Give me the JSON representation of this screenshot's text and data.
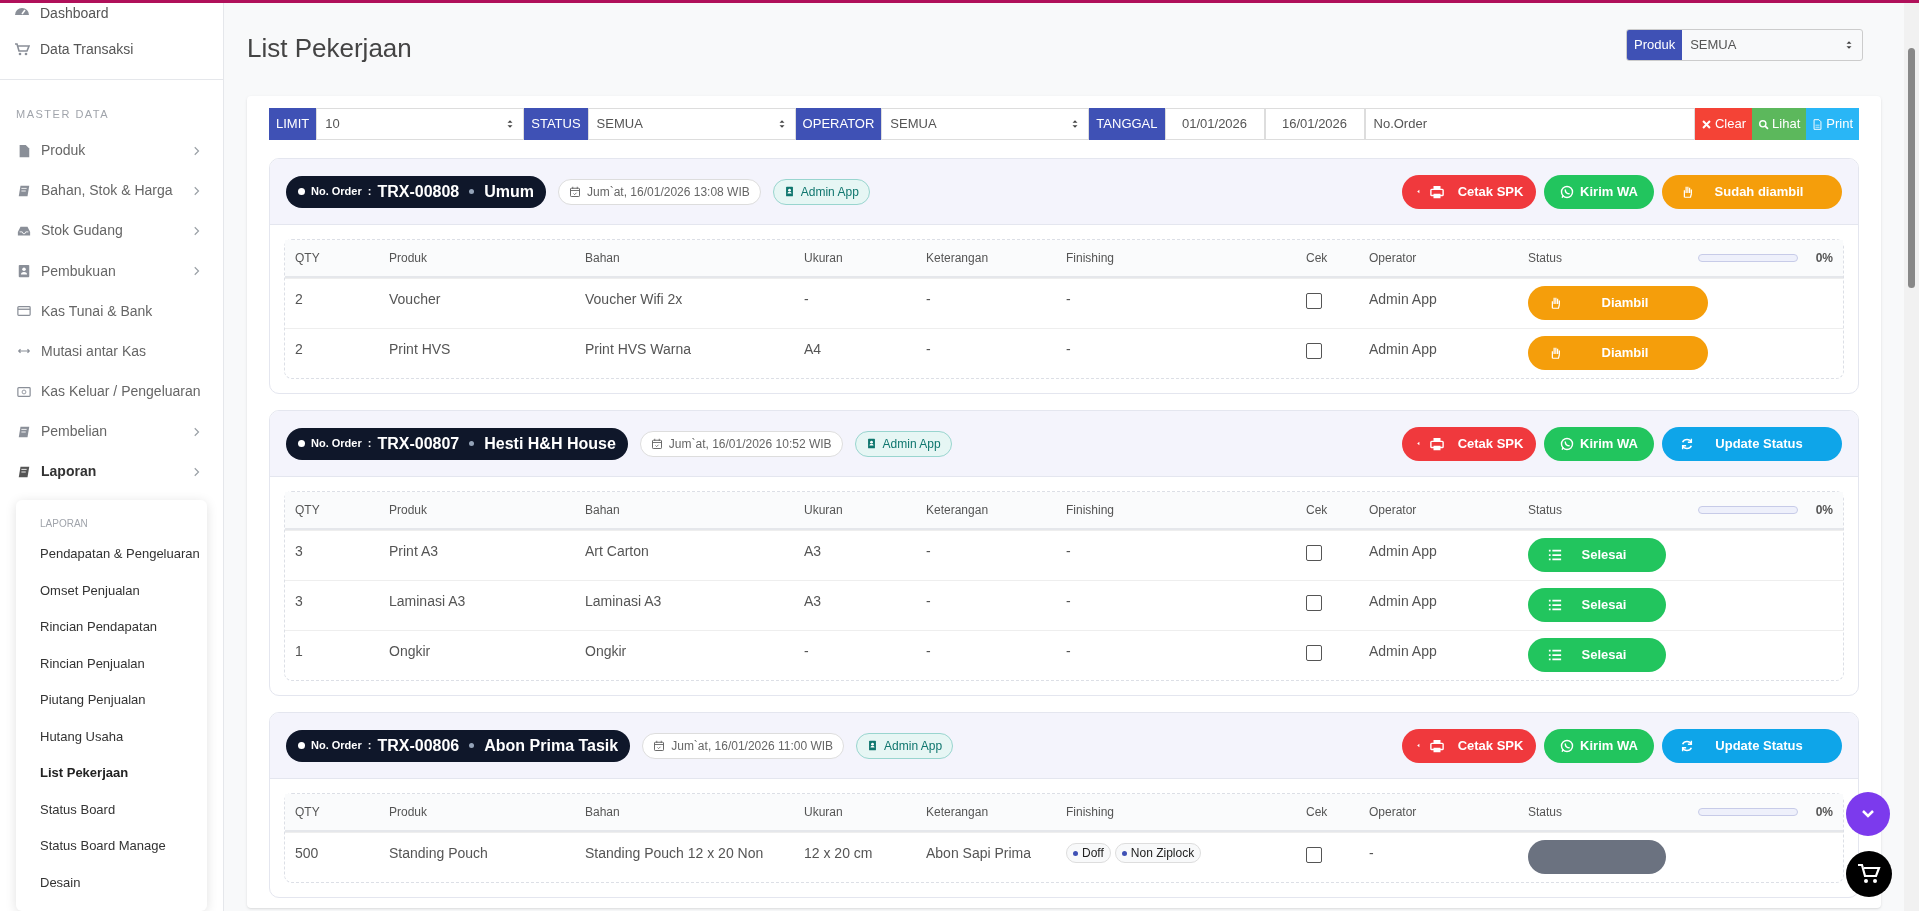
{
  "sidebar": {
    "top_items": [
      {
        "label": "Dashboard"
      },
      {
        "label": "Data Transaksi"
      }
    ],
    "section_label": "MASTER DATA",
    "items": [
      {
        "label": "Produk",
        "expandable": true,
        "selected": false
      },
      {
        "label": "Bahan, Stok & Harga",
        "expandable": true,
        "selected": false
      },
      {
        "label": "Stok Gudang",
        "expandable": true,
        "selected": false
      },
      {
        "label": "Pembukuan",
        "expandable": true,
        "selected": false
      },
      {
        "label": "Kas Tunai & Bank",
        "expandable": false,
        "selected": false
      },
      {
        "label": "Mutasi antar Kas",
        "expandable": false,
        "selected": false
      },
      {
        "label": "Kas Keluar / Pengeluaran",
        "expandable": false,
        "selected": false
      },
      {
        "label": "Pembelian",
        "expandable": true,
        "selected": false
      },
      {
        "label": "Laporan",
        "expandable": true,
        "selected": true
      }
    ],
    "submenu": {
      "title": "LAPORAN",
      "items": [
        {
          "label": "Pendapatan & Pengeluaran",
          "selected": false
        },
        {
          "label": "Omset Penjualan",
          "selected": false
        },
        {
          "label": "Rincian Pendapatan",
          "selected": false
        },
        {
          "label": "Rincian Penjualan",
          "selected": false
        },
        {
          "label": "Piutang Penjualan",
          "selected": false
        },
        {
          "label": "Hutang Usaha",
          "selected": false
        },
        {
          "label": "List Pekerjaan",
          "selected": true
        },
        {
          "label": "Status Board",
          "selected": false
        },
        {
          "label": "Status Board Manage",
          "selected": false
        },
        {
          "label": "Desain",
          "selected": false
        }
      ]
    }
  },
  "page_title": "List Pekerjaan",
  "product_filter": {
    "label": "Produk",
    "value": "SEMUA"
  },
  "filters": [
    {
      "label": "LIMIT",
      "value": "10"
    },
    {
      "label": "STATUS",
      "value": "SEMUA"
    },
    {
      "label": "OPERATOR",
      "value": "SEMUA"
    }
  ],
  "date_filter": {
    "label": "TANGGAL",
    "from": "01/01/2026",
    "to": "16/01/2026"
  },
  "order_search": {
    "placeholder": "No.Order"
  },
  "filter_buttons": [
    {
      "label": "Clear",
      "kind": "clear"
    },
    {
      "label": "Lihat",
      "kind": "view"
    },
    {
      "label": "Print",
      "kind": "print"
    }
  ],
  "orders": [
    {
      "order_label": "No. Order",
      "separator": ":",
      "number": "TRX-00808",
      "customer": "Umum",
      "date": "Jum`at, 16/01/2026 13:08 WIB",
      "source": "Admin App",
      "actions": [
        {
          "label": "Cetak SPK",
          "kind": "spk"
        },
        {
          "label": "Kirim WA",
          "kind": "wa"
        },
        {
          "label": "Sudah diambil",
          "kind": "taken"
        }
      ],
      "columns": [
        "QTY",
        "Produk",
        "Bahan",
        "Ukuran",
        "Keterangan",
        "Finishing",
        "Cek",
        "Operator",
        "Status"
      ],
      "progress": {
        "level": 0,
        "reading": "0%"
      },
      "rows": [
        {
          "qty": "2",
          "product": "Voucher",
          "material": "Voucher Wifi 2x",
          "size": "-",
          "note": "-",
          "finishing": "-",
          "checked": false,
          "operator": "Admin App",
          "status": {
            "label": "Diambil",
            "kind": "taken"
          }
        },
        {
          "qty": "2",
          "product": "Print HVS",
          "material": "Print HVS Warna",
          "size": "A4",
          "note": "-",
          "finishing": "-",
          "checked": false,
          "operator": "Admin App",
          "status": {
            "label": "Diambil",
            "kind": "taken"
          }
        }
      ]
    },
    {
      "order_label": "No. Order",
      "separator": ":",
      "number": "TRX-00807",
      "customer": "Hesti H&H House",
      "date": "Jum`at, 16/01/2026 10:52 WIB",
      "source": "Admin App",
      "actions": [
        {
          "label": "Cetak SPK",
          "kind": "spk"
        },
        {
          "label": "Kirim WA",
          "kind": "wa"
        },
        {
          "label": "Update Status",
          "kind": "update"
        }
      ],
      "columns": [
        "QTY",
        "Produk",
        "Bahan",
        "Ukuran",
        "Keterangan",
        "Finishing",
        "Cek",
        "Operator",
        "Status"
      ],
      "progress": {
        "level": 0,
        "reading": "0%"
      },
      "rows": [
        {
          "qty": "3",
          "product": "Print A3",
          "material": "Art Carton",
          "size": "A3",
          "note": "-",
          "finishing": "-",
          "checked": false,
          "operator": "Admin App",
          "status": {
            "label": "Selesai",
            "kind": "done"
          }
        },
        {
          "qty": "3",
          "product": "Laminasi A3",
          "material": "Laminasi A3",
          "size": "A3",
          "note": "-",
          "finishing": "-",
          "checked": false,
          "operator": "Admin App",
          "status": {
            "label": "Selesai",
            "kind": "done"
          }
        },
        {
          "qty": "1",
          "product": "Ongkir",
          "material": "Ongkir",
          "size": "-",
          "note": "-",
          "finishing": "-",
          "checked": false,
          "operator": "Admin App",
          "status": {
            "label": "Selesai",
            "kind": "done"
          }
        }
      ]
    },
    {
      "order_label": "No. Order",
      "separator": ":",
      "number": "TRX-00806",
      "customer": "Abon Prima Tasik",
      "date": "Jum`at, 16/01/2026 11:00 WIB",
      "source": "Admin App",
      "actions": [
        {
          "label": "Cetak SPK",
          "kind": "spk"
        },
        {
          "label": "Kirim WA",
          "kind": "wa"
        },
        {
          "label": "Update Status",
          "kind": "update"
        }
      ],
      "columns": [
        "QTY",
        "Produk",
        "Bahan",
        "Ukuran",
        "Keterangan",
        "Finishing",
        "Cek",
        "Operator",
        "Status"
      ],
      "progress": {
        "level": 0,
        "reading": "0%"
      },
      "rows": [
        {
          "qty": "500",
          "product": "Standing Pouch",
          "material": "Standing Pouch 12 x 20 Non",
          "size": "12 x 20 cm",
          "note": "Abon Sapi Prima",
          "finishing_tags": [
            "Doff",
            "Non Ziplock"
          ],
          "checked": false,
          "operator": "-",
          "status": {
            "kind": "pending"
          }
        }
      ]
    }
  ]
}
